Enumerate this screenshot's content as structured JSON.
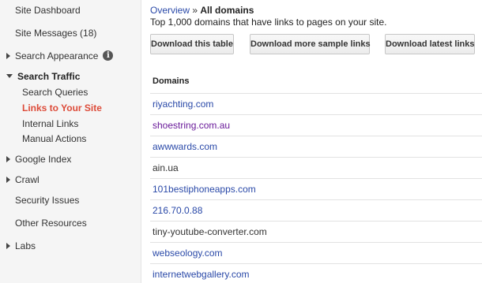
{
  "sidebar": {
    "site_dashboard": "Site Dashboard",
    "site_messages": "Site Messages (18)",
    "search_appearance": "Search Appearance",
    "search_traffic": "Search Traffic",
    "search_queries": "Search Queries",
    "links_to_your_site": "Links to Your Site",
    "internal_links": "Internal Links",
    "manual_actions": "Manual Actions",
    "google_index": "Google Index",
    "crawl": "Crawl",
    "security_issues": "Security Issues",
    "other_resources": "Other Resources",
    "labs": "Labs",
    "info_icon_glyph": "i"
  },
  "breadcrumb": {
    "overview": "Overview",
    "separator": "»",
    "current": "All domains"
  },
  "subtitle": "Top 1,000 domains that have links to pages on your site.",
  "buttons": {
    "download_table": "Download this table",
    "download_more": "Download more sample links",
    "download_latest": "Download latest links"
  },
  "table": {
    "header": "Domains",
    "rows": [
      "riyachting.com",
      "shoestring.com.au",
      "awwwards.com",
      "ain.ua",
      "101bestiphoneapps.com",
      "216.70.0.88",
      "tiny-youtube-converter.com",
      "webseology.com",
      "internetwebgallery.com"
    ]
  },
  "colors": {
    "link": "#2a49a8",
    "visited_link": "#6a1b9a",
    "active_nav": "#dd4b39",
    "sidebar_bg": "#f5f5f5"
  }
}
